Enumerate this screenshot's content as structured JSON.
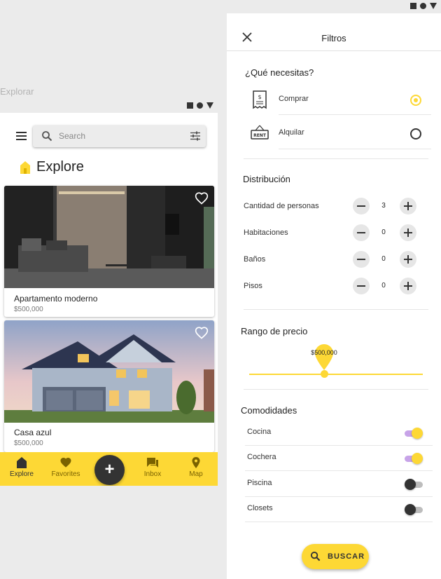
{
  "left": {
    "caption": "Explorar",
    "search": {
      "placeholder": "Search"
    },
    "header": {
      "title": "Explore"
    },
    "cards": [
      {
        "title": "Apartamento moderno",
        "price": "$500,000"
      },
      {
        "title": "Casa azul",
        "price": "$500,000"
      }
    ],
    "nav": {
      "explore": "Explore",
      "favorites": "Favorites",
      "fab": "+",
      "inbox": "Inbox",
      "map": "Map"
    }
  },
  "right": {
    "title": "Filtros",
    "need": {
      "heading": "¿Qué necesitas?",
      "options": [
        {
          "label": "Comprar",
          "selected": true
        },
        {
          "label": "Alquilar",
          "selected": false
        }
      ]
    },
    "distribution": {
      "heading": "Distribución",
      "rows": [
        {
          "label": "Cantidad de personas",
          "value": "3"
        },
        {
          "label": "Habitaciones",
          "value": "0"
        },
        {
          "label": "Baños",
          "value": "0"
        },
        {
          "label": "Pisos",
          "value": "0"
        }
      ]
    },
    "price": {
      "heading": "Rango de precio",
      "value_label": "$500,000"
    },
    "amenities": {
      "heading": "Comodidades",
      "items": [
        {
          "label": "Cocina",
          "on": true
        },
        {
          "label": "Cochera",
          "on": true
        },
        {
          "label": "Piscina",
          "on": false
        },
        {
          "label": "Closets",
          "on": false
        }
      ]
    },
    "button": "BUSCAR"
  },
  "colors": {
    "accent": "#fdd835",
    "dark": "#333333",
    "toggle_track_on": "#c7a3e8"
  }
}
